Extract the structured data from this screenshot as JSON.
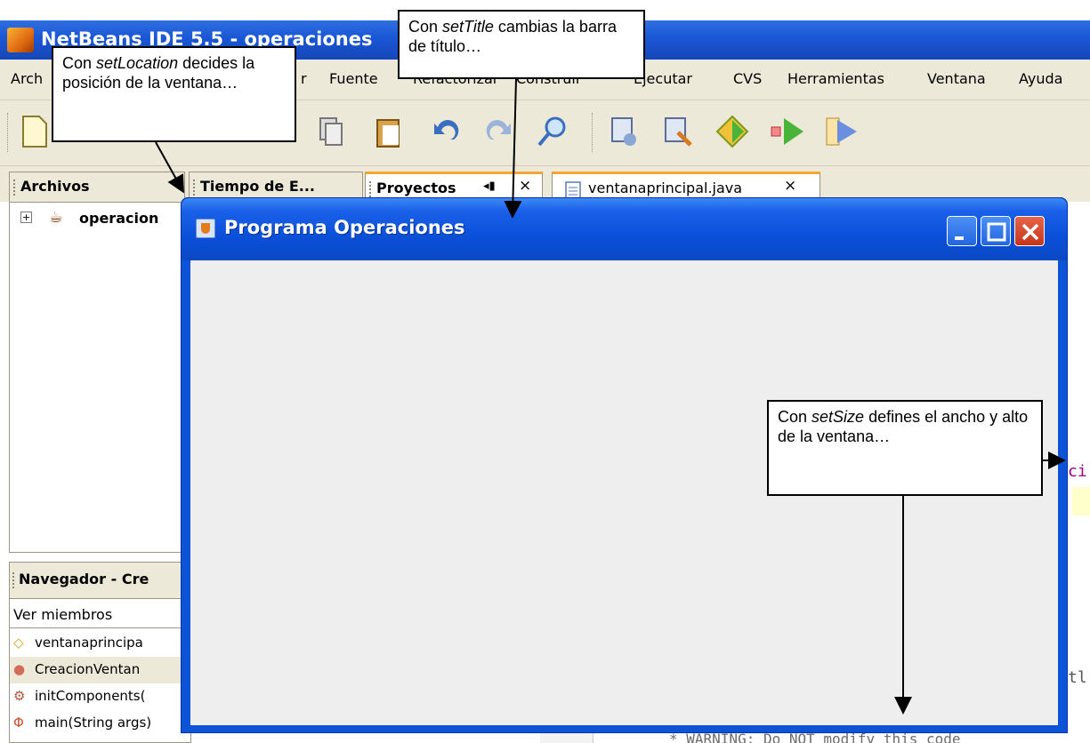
{
  "ide": {
    "title": "NetBeans IDE 5.5 - operaciones"
  },
  "menu": {
    "items": [
      "Arch",
      "r",
      "Fuente",
      "Refactorizar",
      "Construir",
      "Ejecutar",
      "CVS",
      "Herramientas",
      "Ventana",
      "Ayuda"
    ]
  },
  "tabs": {
    "archivos": "Archivos",
    "tiempo": "Tiempo de E...",
    "proyectos": "Proyectos",
    "proyectos_pin": "◂▮",
    "proyectos_close": "×",
    "editor_file": "ventanaprincipal.java",
    "editor_close": "×"
  },
  "files_tree": {
    "expander": "+",
    "root_label": "operacion"
  },
  "navigator": {
    "title": "Navegador - Cre",
    "view_select": "Ver miembros",
    "rows": [
      {
        "icon": "◇",
        "label": "ventanaprincipa"
      },
      {
        "icon": "●",
        "label": "CreacionVentan"
      },
      {
        "icon": "⚙",
        "label": "initComponents("
      },
      {
        "icon": "Φ",
        "label": "main(String args)"
      }
    ]
  },
  "editor": {
    "peek_1": "ci",
    "peek_2": "tl",
    "peek_3": "* WARNING: Do NOT modify this code"
  },
  "jframe": {
    "title": "Programa Operaciones",
    "minimize": "minimize",
    "maximize": "maximize",
    "close": "close"
  },
  "callouts": {
    "location": {
      "method": "setLocation",
      "prefix": "Con ",
      "text": " decides la posición de la ventana…"
    },
    "title": {
      "method": "setTitle",
      "prefix": "Con ",
      "text": " cambias la barra de título…"
    },
    "size": {
      "method": "setSize",
      "prefix": "Con ",
      "text": " defines el ancho y alto de la ventana…"
    }
  },
  "colors": {
    "xp_blue": "#0c53d8",
    "ide_background": "#ece9d8",
    "close_red": "#c7351a",
    "tab_accent": "#f4a431"
  }
}
